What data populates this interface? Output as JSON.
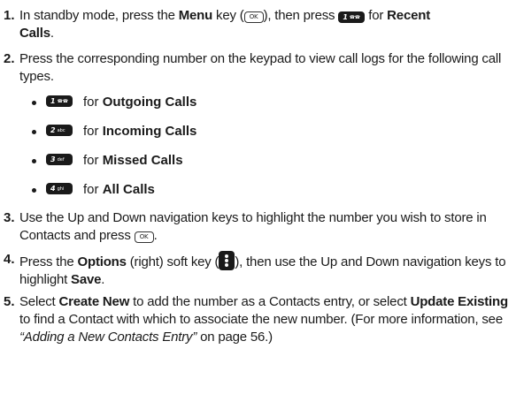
{
  "steps": [
    {
      "num": "1.",
      "t1": "In standby mode, press the ",
      "b1": "Menu",
      "t2": " key (",
      "ok": "OK",
      "t3": "), then press ",
      "key_digit": "1",
      "key_sub": "☎☎",
      "t4": " for ",
      "b2": "Recent",
      "b3": "Calls",
      "t5": "."
    },
    {
      "num": "2.",
      "text": "Press the corresponding number on the keypad to view call logs for the following call types."
    },
    {
      "num": "3.",
      "t1": "Use the Up and Down navigation keys to highlight the number you wish to store in Contacts and press ",
      "ok": "OK",
      "t2": "."
    },
    {
      "num": "4.",
      "t1": "Press the ",
      "b1": "Options",
      "t2": " (right) soft key (",
      "t3": "), then use the Up and Down navigation keys to highlight ",
      "b2": "Save",
      "t4": "."
    },
    {
      "num": "5.",
      "t1": "Select ",
      "b1": "Create New",
      "t2": " to add the number as a Contacts entry, or select ",
      "b2": "Update Existing",
      "t3": " to find a Contact with which to associate the new number. (For more information, see ",
      "i1": "“Adding a New Contacts Entry”",
      "t4": " on page 56.)"
    }
  ],
  "call_types": [
    {
      "key_digit": "1",
      "key_sub": "☎☎",
      "prefix": "for ",
      "label": "Outgoing Calls"
    },
    {
      "key_digit": "2",
      "key_sub": "abc",
      "prefix": "for ",
      "label": "Incoming Calls"
    },
    {
      "key_digit": "3",
      "key_sub": "def",
      "prefix": "for ",
      "label": "Missed Calls"
    },
    {
      "key_digit": "4",
      "key_sub": "ghi",
      "prefix": "for ",
      "label": "All Calls"
    }
  ],
  "colors": {
    "text": "#1a1a1a",
    "key_fill": "#1a1a1a",
    "background": "#ffffff"
  }
}
